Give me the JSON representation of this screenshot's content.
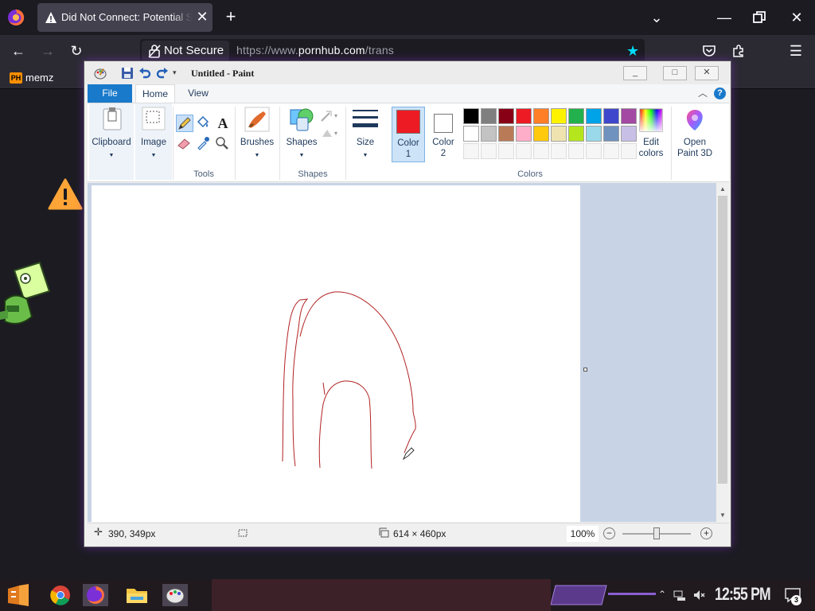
{
  "browser": {
    "tab_title": "Did Not Connect: Potential Security Issue",
    "tab_close": "✕",
    "new_tab": "+",
    "url_security_label": "Not Secure",
    "url_prefix": "https://www.",
    "url_domain": "pornhub.com",
    "url_path": "/trans",
    "bookmark_label": "memz",
    "bookmark_favicon": "PH"
  },
  "paint": {
    "window_title": "Untitled - Paint",
    "tabs": {
      "file": "File",
      "home": "Home",
      "view": "View"
    },
    "groups": {
      "clipboard": "Clipboard",
      "image": "Image",
      "tools": "Tools",
      "brushes": "Brushes",
      "shapes": "Shapes",
      "shapes_group": "Shapes",
      "size": "Size",
      "color1": "Color",
      "color1_num": "1",
      "color2": "Color",
      "color2_num": "2",
      "colors": "Colors",
      "edit_colors_1": "Edit",
      "edit_colors_2": "colors",
      "open_3d_1": "Open",
      "open_3d_2": "Paint 3D"
    },
    "color1_value": "#ed1c24",
    "color2_value": "#ffffff",
    "palette_row1": [
      "#000000",
      "#7f7f7f",
      "#880015",
      "#ed1c24",
      "#ff7f27",
      "#fff200",
      "#22b14c",
      "#00a2e8",
      "#3f48cc",
      "#a349a4"
    ],
    "palette_row2": [
      "#ffffff",
      "#c3c3c3",
      "#b97a57",
      "#ffaec9",
      "#ffc90e",
      "#efe4b0",
      "#b5e61d",
      "#99d9ea",
      "#7092be",
      "#c8bfe7"
    ],
    "status": {
      "cursor_pos": "390, 349px",
      "image_size": "614 × 460px",
      "zoom": "100%"
    }
  },
  "taskbar": {
    "clock": "12:55 PM",
    "notif_count": "3"
  },
  "colors": {
    "stroke": "#b22222",
    "accent": "#1979ca"
  }
}
